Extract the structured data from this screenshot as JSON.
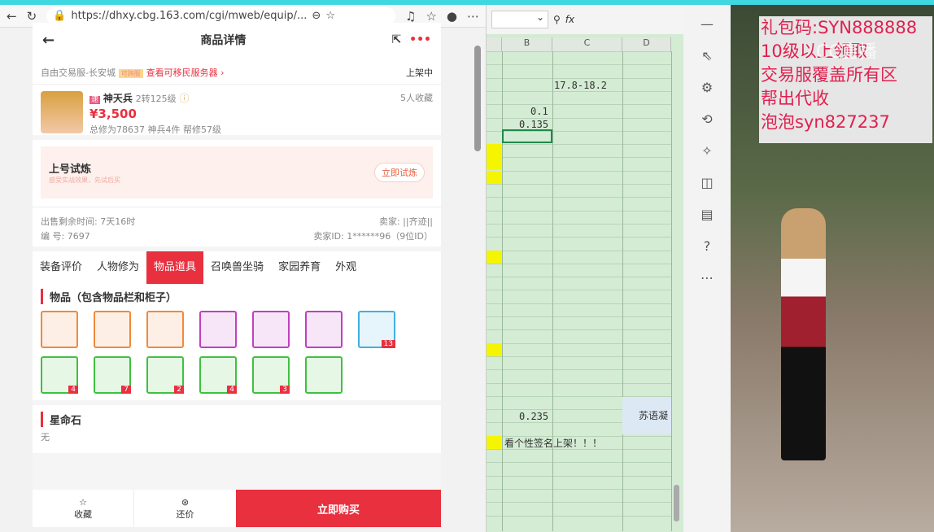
{
  "browser": {
    "url": "https://dhxy.cbg.163.com/cgi/mweb/equip/..."
  },
  "page": {
    "title": "商品详情",
    "server": "自由交易服-长安城",
    "server_badge": "可跨服",
    "migrate_link": "查看可移民服务器 ›",
    "status": "上架中",
    "role": {
      "badge": "速",
      "name": "神天兵",
      "level": "2转125级",
      "favorites": "5人收藏",
      "price": "¥3,500",
      "stats": "总修为78637  神兵4件  帮修57级"
    },
    "trial": {
      "title": "上号试炼",
      "subtitle": "感受实战效果，先试后买",
      "button": "立即试炼"
    },
    "info": {
      "remain": "出售剩余时间: 7天16时",
      "seller": "卖家: ||齐迹||",
      "serial": "编  号: 7697",
      "seller_id": "卖家ID: 1******96（9位ID）"
    },
    "tabs": [
      "装备评价",
      "人物修为",
      "物品道具",
      "召唤兽坐骑",
      "家园养育",
      "外观"
    ],
    "items_title": "物品（包含物品栏和柜子）",
    "items": [
      {
        "c": "#f08a3c",
        "n": ""
      },
      {
        "c": "#f08a3c",
        "n": ""
      },
      {
        "c": "#f08a3c",
        "n": ""
      },
      {
        "c": "#c040c0",
        "n": ""
      },
      {
        "c": "#c040c0",
        "n": ""
      },
      {
        "c": "#c040c0",
        "n": ""
      },
      {
        "c": "#40b0e0",
        "n": "13"
      },
      {
        "c": "#40c040",
        "n": "4"
      },
      {
        "c": "#40c040",
        "n": "7"
      },
      {
        "c": "#40c040",
        "n": "2"
      },
      {
        "c": "#40c040",
        "n": "4"
      },
      {
        "c": "#40c040",
        "n": "3"
      },
      {
        "c": "#40c040",
        "n": ""
      }
    ],
    "star_title": "星命石",
    "star_value": "无",
    "bottom": {
      "fav": "收藏",
      "bargain": "还价",
      "buy": "立即购买"
    }
  },
  "sheet": {
    "cols": [
      "B",
      "C",
      "D"
    ],
    "c1": "17.8-18.2",
    "b1": "0.1",
    "b2": "0.135",
    "b3": "0.235",
    "note": "看个性签名上架！！！",
    "d": "苏语凝"
  },
  "video": {
    "lines": [
      "礼包码:SYN888888",
      "10级以上领取",
      "交易服覆盖所有区",
      "帮出代收",
      "泡泡syn827237"
    ],
    "watermark": "CC直播"
  }
}
